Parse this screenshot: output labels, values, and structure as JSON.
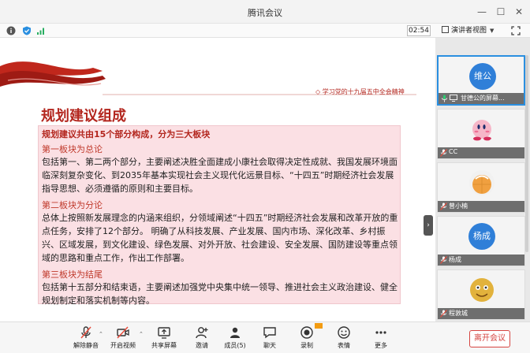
{
  "window": {
    "title": "腾讯会议"
  },
  "topbar": {
    "timer": "02:54",
    "view_label": "演讲者视图"
  },
  "slide": {
    "tagline": "◇ 学习党的十九届五中全会精神",
    "heading": "规划建议组成",
    "subtitle": "规划建议共由15个部分构成，分为三大板块",
    "sections": [
      {
        "title": "第一板块为总论",
        "body": "包括第一、第二两个部分，主要阐述决胜全面建成小康社会取得决定性成就、我国发展环境面临深刻复杂变化、到2035年基本实现社会主义现代化远景目标、“十四五”时期经济社会发展指导思想、必须遵循的原则和主要目标。"
      },
      {
        "title": "第二板块为分论",
        "body": "总体上按照新发展理念的内涵来组织，分领域阐述“十四五”时期经济社会发展和改革开放的重点任务，安排了12个部分。 明确了从科技发展、产业发展、国内市场、深化改革、乡村振兴、区域发展，到文化建设、绿色发展、对外开放、社会建设、安全发展、国防建设等重点领域的思路和重点工作，作出工作部署。"
      },
      {
        "title": "第三板块为结尾",
        "body": "包括第十五部分和结束语，主要阐述加强党中央集中统一领导、推进社会主义政治建设、健全规划制定和落实机制等内容。"
      }
    ]
  },
  "participants": [
    {
      "name": "甘德公的屏幕...",
      "avatar_text": "维公",
      "avatar_color": "#2f7fd8",
      "active": true
    },
    {
      "name": "CC",
      "avatar_text": "",
      "avatar_color": "#f6b6c8",
      "active": false
    },
    {
      "name": "曾小楠",
      "avatar_text": "",
      "avatar_color": "#f0a040",
      "active": false
    },
    {
      "name": "杨成",
      "avatar_text": "杨成",
      "avatar_color": "#2f7fd8",
      "active": false
    },
    {
      "name": "程敦城",
      "avatar_text": "",
      "avatar_color": "#e2b23c",
      "active": false
    }
  ],
  "toolbar": {
    "unmute": "解除静音",
    "video": "开启视频",
    "share": "共享屏幕",
    "invite": "邀请",
    "members": "成员(5)",
    "chat": "聊天",
    "record": "录制",
    "reaction": "表情",
    "more": "更多",
    "leave": "离开会议"
  },
  "colors": {
    "accent": "#2a8fe0",
    "danger": "#d64541",
    "slide_red": "#b3261e"
  }
}
